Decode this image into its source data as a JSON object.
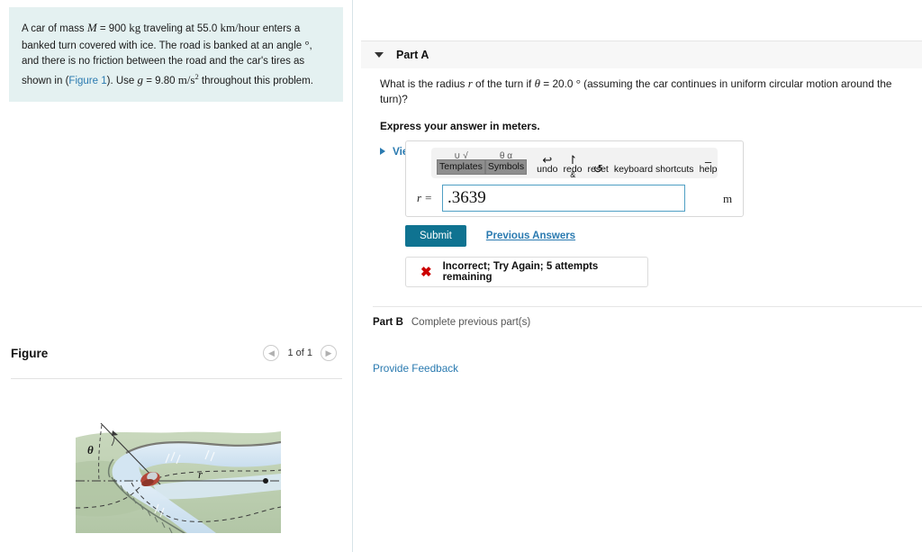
{
  "problem": {
    "line1_a": "A car of mass ",
    "var_M": "M",
    "eq1": " = 900 ",
    "unit_kg": "kg",
    "line1_b": " traveling at 55.0 ",
    "unit_kmh": "km/hour",
    "line1_c": " enters a banked",
    "line2_a": "turn covered with ice. The road is banked at an angle ",
    "deg_symbol": "°",
    "line2_b": ", and there is no",
    "line3_a": "friction between the road and the car's tires as shown in (",
    "figure_link": "Figure 1",
    "line3_b": "). Use ",
    "var_g": "g",
    "line4_a": " = 9.80 ",
    "unit_ms": "m/s",
    "unit_ms_exp": "2",
    "line4_b": " throughout this problem."
  },
  "figure_panel": {
    "title": "Figure",
    "pager": {
      "prev_icon": "chevron-left-icon",
      "label": "1 of 1",
      "next_icon": "chevron-right-icon"
    },
    "illustration": {
      "angle_label": "θ",
      "radius_label": "r",
      "terrain_color": "#b9cdae",
      "terrain_color_light": "#cbdabf",
      "road_color": "#d6e7f2",
      "road_color_dark": "#c2d9ea",
      "car_color": "#b4483a",
      "car_highlight": "#d9dde0",
      "guardrail_color": "#7d8a7c",
      "line_color": "#3a3a3a"
    }
  },
  "part_a": {
    "caret_icon": "caret-down-icon",
    "title": "Part A",
    "question_a": "What is the radius ",
    "question_var_r": "r",
    "question_b": " of the turn if ",
    "question_var_theta": "θ",
    "question_c": " = 20.0 ",
    "question_deg": "°",
    "question_d": " (assuming the car continues in uniform circular motion around the turn)?",
    "express": "Express your answer in meters.",
    "hints_caret_icon": "caret-right-icon",
    "hints_label": "View Available Hint(s)"
  },
  "math_toolbar": {
    "templates": "Templates",
    "symbols": "Symbols",
    "undo": "undo",
    "redo": "redo",
    "reset": "reset",
    "keyboard_shortcuts": "keyboard shortcuts",
    "help": "help",
    "templates_icon": "math-templates-icon",
    "symbols_icon": "math-symbols-icon",
    "undo_icon": "undo-arrow-icon",
    "redo_icon": "redo-arrow-icon",
    "reset_icon": "reset-circular-arrow-icon",
    "keyboard_icon": "keyboard-icon",
    "help_icon": "minus-icon"
  },
  "answer": {
    "prefix": "r =",
    "value": ".3639",
    "placeholder": "",
    "unit": "m"
  },
  "actions": {
    "submit": "Submit",
    "previous_answers": "Previous Answers"
  },
  "feedback": {
    "icon": "x-mark-icon",
    "message": "Incorrect; Try Again; 5 attempts remaining",
    "icon_color": "#cc0000"
  },
  "part_b": {
    "label": "Part B",
    "note": "Complete previous part(s)"
  },
  "footer": {
    "provide_feedback": "Provide Feedback"
  },
  "colors": {
    "accent_link": "#2a7ab0",
    "submit_bg": "#0f7391",
    "problem_bg": "#e4f1f1",
    "part_header_bg": "#f7f7f7",
    "input_border": "#4f9fc4"
  }
}
